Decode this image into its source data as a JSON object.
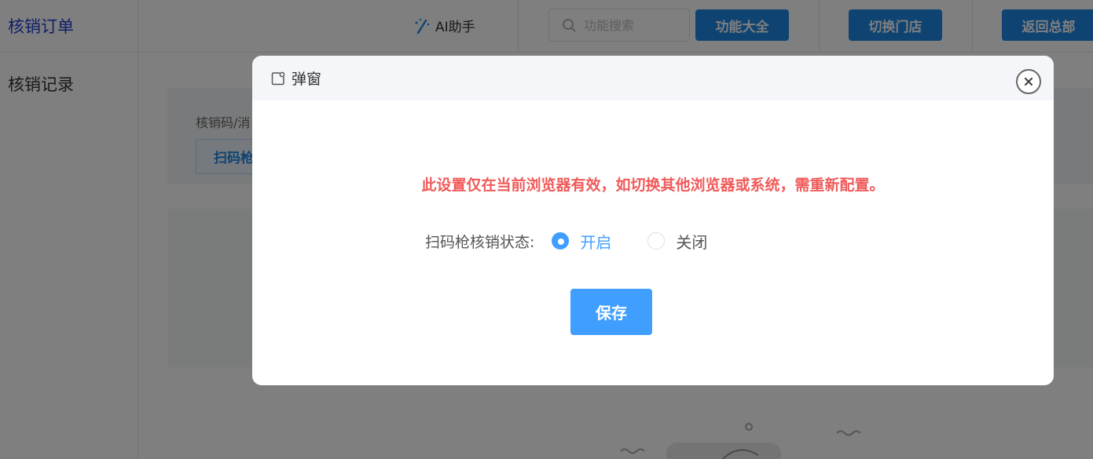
{
  "sidebar": {
    "title": "核销订单",
    "items": [
      {
        "label": "核销记录"
      }
    ]
  },
  "header": {
    "ai_label": "AI助手",
    "search_placeholder": "功能搜索",
    "all_functions": "功能大全",
    "switch_store": "切换门店",
    "back_hq": "返回总部"
  },
  "content": {
    "filter_label": "核销码/消",
    "scan_button": "扫码枪"
  },
  "modal": {
    "title": "弹窗",
    "warning": "此设置仅在当前浏览器有效，如切换其他浏览器或系统，需重新配置。",
    "status_label": "扫码枪核销状态:",
    "options": [
      {
        "label": "开启",
        "checked": true
      },
      {
        "label": "关闭",
        "checked": false
      }
    ],
    "save_label": "保存"
  },
  "colors": {
    "primary": "#1e88e5",
    "radio_active": "#409eff",
    "warning": "#f05a5a",
    "sidebar_title": "#1f3fd1"
  }
}
